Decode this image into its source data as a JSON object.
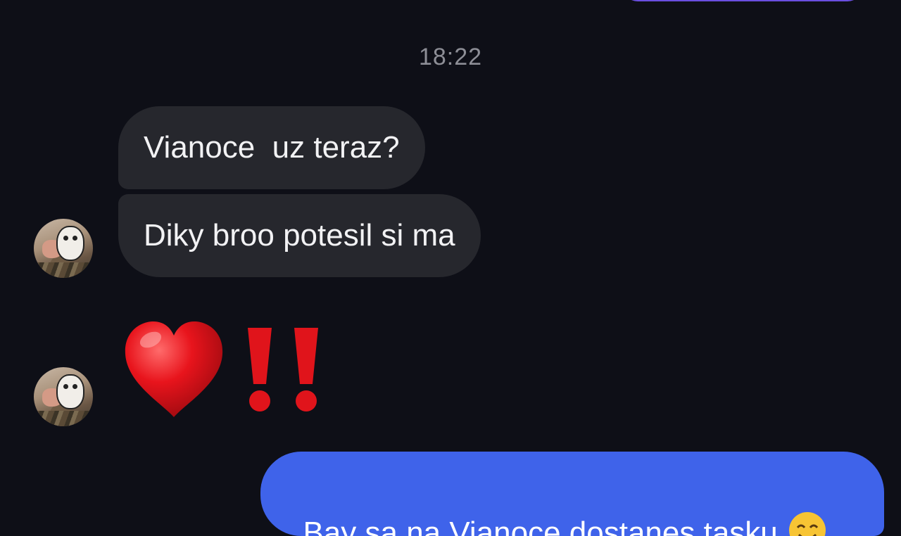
{
  "chat": {
    "timestamp": "18:22",
    "incoming": [
      {
        "text": "Vianoce  uz teraz?"
      },
      {
        "text": "Diky broo potesil si ma"
      }
    ],
    "reaction_icons": [
      "red-heart-icon",
      "double-exclamation-icon"
    ],
    "outgoing": {
      "text": "Bay sa na Vianoce dostanes tasku"
    },
    "colors": {
      "background": "#0e0f17",
      "incoming_bubble": "#26272d",
      "outgoing_bubble": "#3f63ea",
      "top_bubble": "#6a4fe0",
      "heart": "#e0141b"
    }
  }
}
